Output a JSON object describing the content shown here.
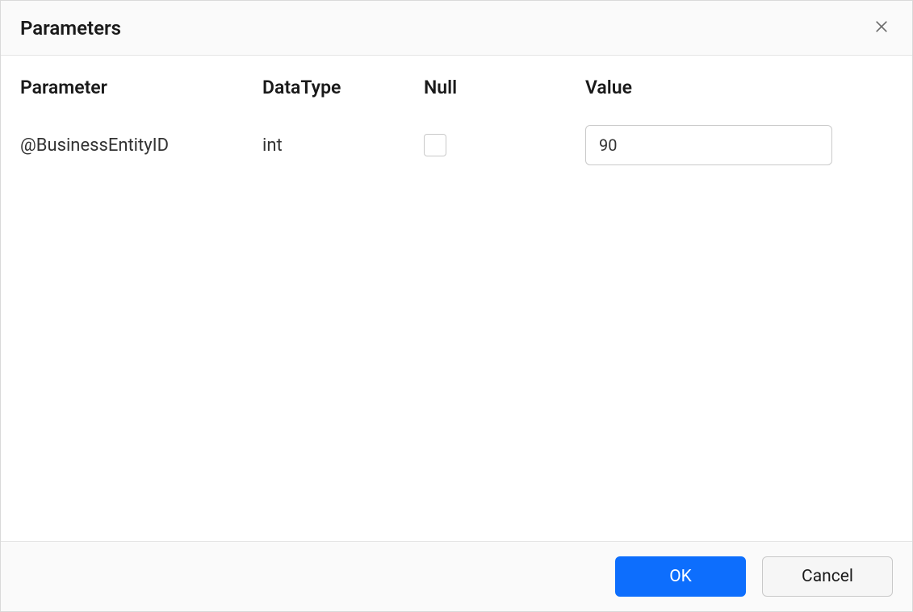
{
  "dialog": {
    "title": "Parameters"
  },
  "table": {
    "headers": {
      "parameter": "Parameter",
      "datatype": "DataType",
      "null": "Null",
      "value": "Value"
    },
    "rows": [
      {
        "parameter": "@BusinessEntityID",
        "datatype": "int",
        "is_null": false,
        "value": "90"
      }
    ]
  },
  "footer": {
    "ok_label": "OK",
    "cancel_label": "Cancel"
  }
}
